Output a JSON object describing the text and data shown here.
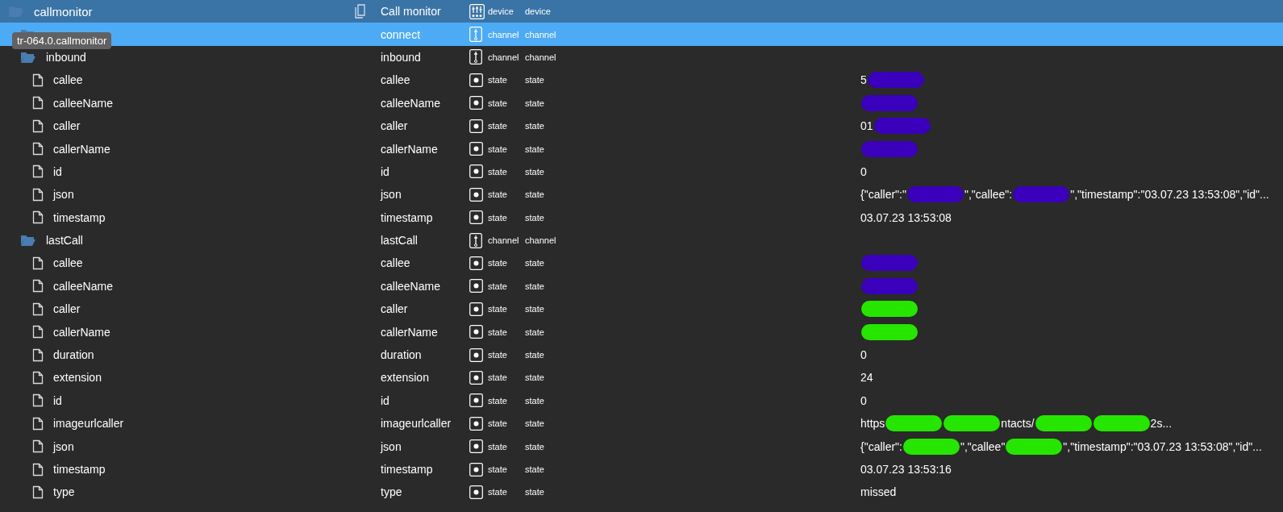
{
  "tree": [
    {
      "kind": "device",
      "name": "callmonitor",
      "title": "Call monitor",
      "type": "device",
      "role": "device",
      "selected": false,
      "children": [
        {
          "kind": "channel",
          "title": "connect",
          "type": "channel",
          "role": "channel",
          "selected": true
        },
        {
          "kind": "channel",
          "name": "inbound",
          "title": "inbound",
          "type": "channel",
          "role": "channel",
          "selected": false,
          "children": [
            {
              "kind": "state",
              "name": "callee",
              "title": "callee",
              "type": "state",
              "role": "state",
              "selected": false,
              "value": [
                {
                  "kind": "text",
                  "text": "5"
                },
                {
                  "kind": "redaction",
                  "color": "#3a00bb"
                }
              ]
            },
            {
              "kind": "state",
              "name": "calleeName",
              "title": "calleeName",
              "type": "state",
              "role": "state",
              "selected": false,
              "value": [
                {
                  "kind": "redaction",
                  "color": "#3a00bb"
                }
              ]
            },
            {
              "kind": "state",
              "name": "caller",
              "title": "caller",
              "type": "state",
              "role": "state",
              "selected": false,
              "value": [
                {
                  "kind": "text",
                  "text": "01"
                },
                {
                  "kind": "redaction",
                  "color": "#3a00bb"
                }
              ]
            },
            {
              "kind": "state",
              "name": "callerName",
              "title": "callerName",
              "type": "state",
              "role": "state",
              "selected": false,
              "value": [
                {
                  "kind": "redaction",
                  "color": "#3a00bb"
                }
              ]
            },
            {
              "kind": "state",
              "name": "id",
              "title": "id",
              "type": "state",
              "role": "state",
              "selected": false,
              "value": [
                {
                  "kind": "text",
                  "text": "0"
                }
              ]
            },
            {
              "kind": "state",
              "name": "json",
              "title": "json",
              "type": "state",
              "role": "state",
              "selected": false,
              "value": [
                {
                  "kind": "text",
                  "text": "{\"caller\":\""
                },
                {
                  "kind": "redaction",
                  "color": "#3a00bb"
                },
                {
                  "kind": "text",
                  "text": "\",\"callee\":"
                },
                {
                  "kind": "redaction",
                  "color": "#3a00bb"
                },
                {
                  "kind": "text",
                  "text": "\",\"timestamp\":\"03.07.23 13:53:08\",\"id\"..."
                }
              ]
            },
            {
              "kind": "state",
              "name": "timestamp",
              "title": "timestamp",
              "type": "state",
              "role": "state",
              "selected": false,
              "value": [
                {
                  "kind": "text",
                  "text": "03.07.23 13:53:08"
                }
              ]
            }
          ]
        },
        {
          "kind": "channel",
          "name": "lastCall",
          "title": "lastCall",
          "type": "channel",
          "role": "channel",
          "selected": false,
          "children": [
            {
              "kind": "state",
              "name": "callee",
              "title": "callee",
              "type": "state",
              "role": "state",
              "selected": false,
              "value": [
                {
                  "kind": "redaction",
                  "color": "#3a00bb"
                }
              ]
            },
            {
              "kind": "state",
              "name": "calleeName",
              "title": "calleeName",
              "type": "state",
              "role": "state",
              "selected": false,
              "value": [
                {
                  "kind": "redaction",
                  "color": "#3a00bb"
                }
              ]
            },
            {
              "kind": "state",
              "name": "caller",
              "title": "caller",
              "type": "state",
              "role": "state",
              "selected": false,
              "value": [
                {
                  "kind": "redaction",
                  "color": "#26e600"
                }
              ]
            },
            {
              "kind": "state",
              "name": "callerName",
              "title": "callerName",
              "type": "state",
              "role": "state",
              "selected": false,
              "value": [
                {
                  "kind": "redaction",
                  "color": "#26e600"
                }
              ]
            },
            {
              "kind": "state",
              "name": "duration",
              "title": "duration",
              "type": "state",
              "role": "state",
              "selected": false,
              "value": [
                {
                  "kind": "text",
                  "text": "0"
                }
              ]
            },
            {
              "kind": "state",
              "name": "extension",
              "title": "extension",
              "type": "state",
              "role": "state",
              "selected": false,
              "value": [
                {
                  "kind": "text",
                  "text": "24"
                }
              ]
            },
            {
              "kind": "state",
              "name": "id",
              "title": "id",
              "type": "state",
              "role": "state",
              "selected": false,
              "value": [
                {
                  "kind": "text",
                  "text": "0"
                }
              ]
            },
            {
              "kind": "state",
              "name": "imageurlcaller",
              "title": "imageurlcaller",
              "type": "state",
              "role": "state",
              "selected": false,
              "value": [
                {
                  "kind": "text",
                  "text": "https"
                },
                {
                  "kind": "redaction",
                  "color": "#26e600"
                },
                {
                  "kind": "redaction",
                  "color": "#26e600"
                },
                {
                  "kind": "text",
                  "text": "ntacts/"
                },
                {
                  "kind": "redaction",
                  "color": "#26e600"
                },
                {
                  "kind": "redaction",
                  "color": "#26e600"
                },
                {
                  "kind": "text",
                  "text": "2s..."
                }
              ]
            },
            {
              "kind": "state",
              "name": "json",
              "title": "json",
              "type": "state",
              "role": "state",
              "selected": false,
              "value": [
                {
                  "kind": "text",
                  "text": "{\"caller\":"
                },
                {
                  "kind": "redaction",
                  "color": "#26e600"
                },
                {
                  "kind": "text",
                  "text": "\",\"callee\""
                },
                {
                  "kind": "redaction",
                  "color": "#26e600"
                },
                {
                  "kind": "text",
                  "text": "\",\"timestamp\":\"03.07.23 13:53:08\",\"id\"..."
                }
              ]
            },
            {
              "kind": "state",
              "name": "timestamp",
              "title": "timestamp",
              "type": "state",
              "role": "state",
              "selected": false,
              "value": [
                {
                  "kind": "text",
                  "text": "03.07.23 13:53:16"
                }
              ]
            },
            {
              "kind": "state",
              "name": "type",
              "title": "type",
              "type": "state",
              "role": "state",
              "selected": false,
              "value": [
                {
                  "kind": "text",
                  "text": "missed"
                }
              ]
            }
          ]
        }
      ]
    }
  ],
  "tooltip": "tr-064.0.callmonitor"
}
